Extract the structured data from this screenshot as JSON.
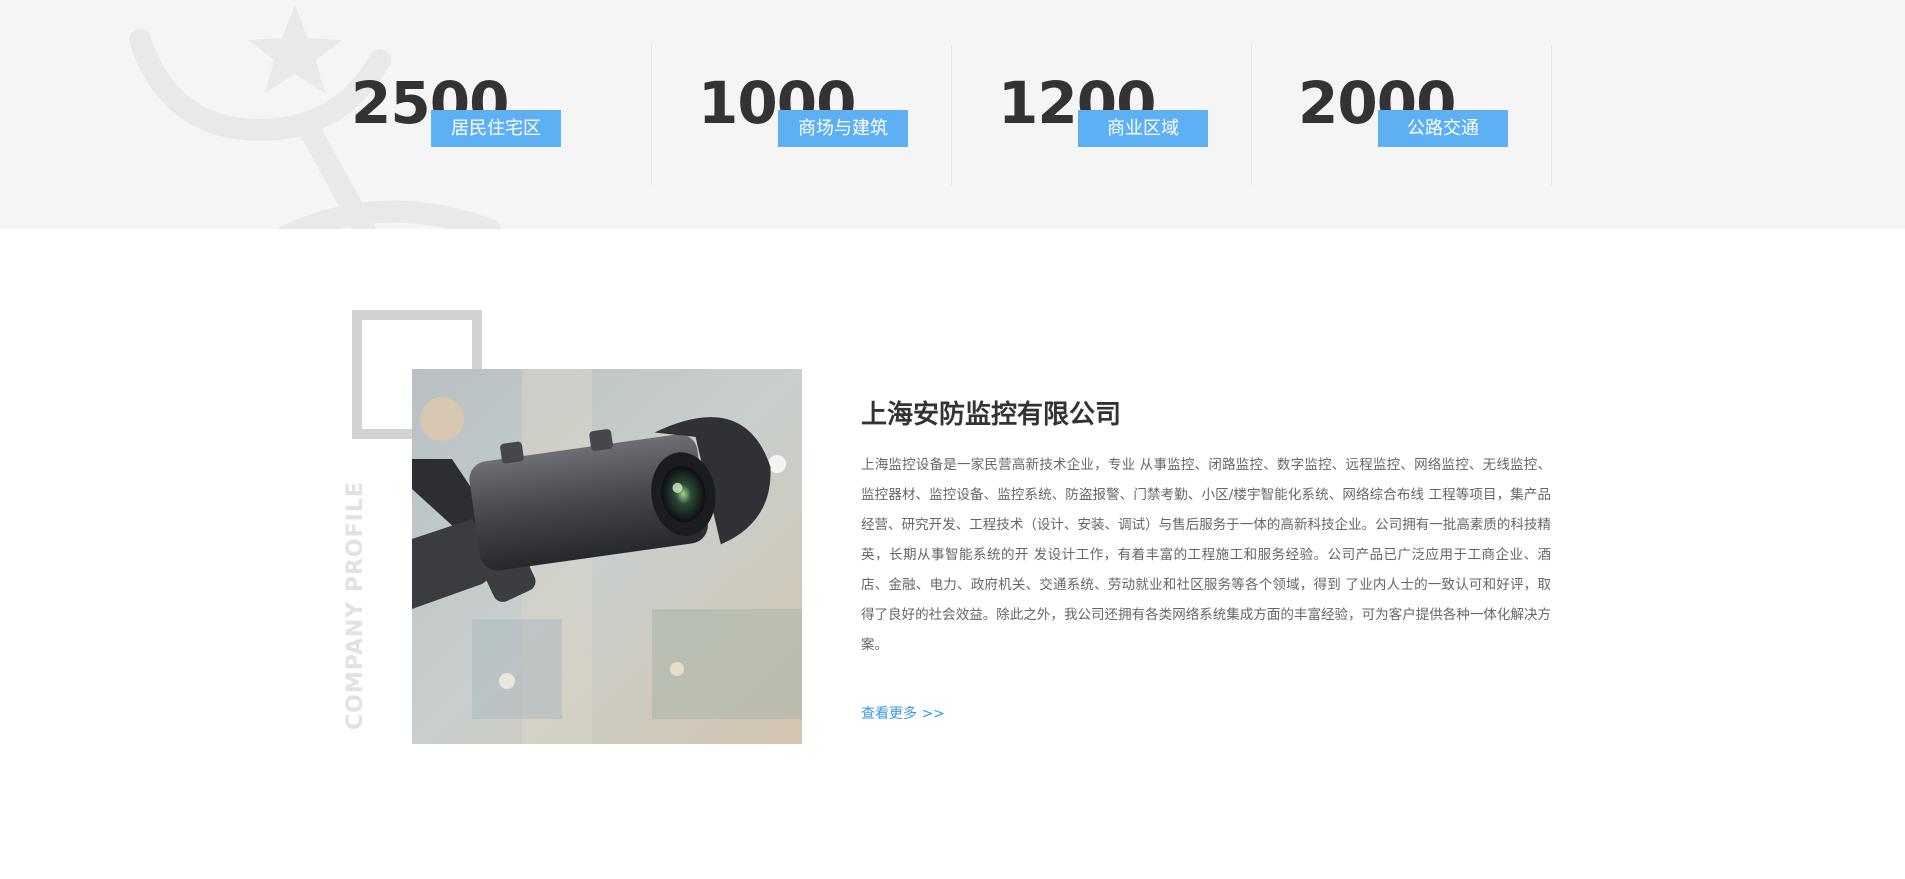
{
  "stats": [
    {
      "number": "2500",
      "label": "居民住宅区"
    },
    {
      "number": "1000",
      "label": "商场与建筑"
    },
    {
      "number": "1200",
      "label": "商业区域"
    },
    {
      "number": "2000",
      "label": "公路交通"
    }
  ],
  "profile": {
    "vertical_label": "COMPANY PROFILE",
    "title": "上海安防监控有限公司",
    "description": "上海监控设备是一家民营高新技术企业，专业 从事监控、闭路监控、数字监控、远程监控、网络监控、无线监控、监控器材、监控设备、监控系统、防盗报警、门禁考勤、小区/楼宇智能化系统、网络综合布线 工程等项目，集产品经营、研究开发、工程技术（设计、安装、调试）与售后服务于一体的高新科技企业。公司拥有一批高素质的科技精英，长期从事智能系统的开 发设计工作，有着丰富的工程施工和服务经验。公司产品已广泛应用于工商企业、酒店、金融、电力、政府机关、交通系统、劳动就业和社区服务等各个领域，得到 了业内人士的一致认可和好评，取得了良好的社会效益。除此之外，我公司还拥有各类网络系统集成方面的丰富经验，可为客户提供各种一体化解决方案。",
    "more_label": "查看更多 >>"
  },
  "colors": {
    "accent": "#5eb0f4",
    "link": "#3a9ae8",
    "band_bg": "#f5f5f5"
  },
  "icons": {
    "background": "trophy-icon",
    "photo": "security-camera-image"
  }
}
